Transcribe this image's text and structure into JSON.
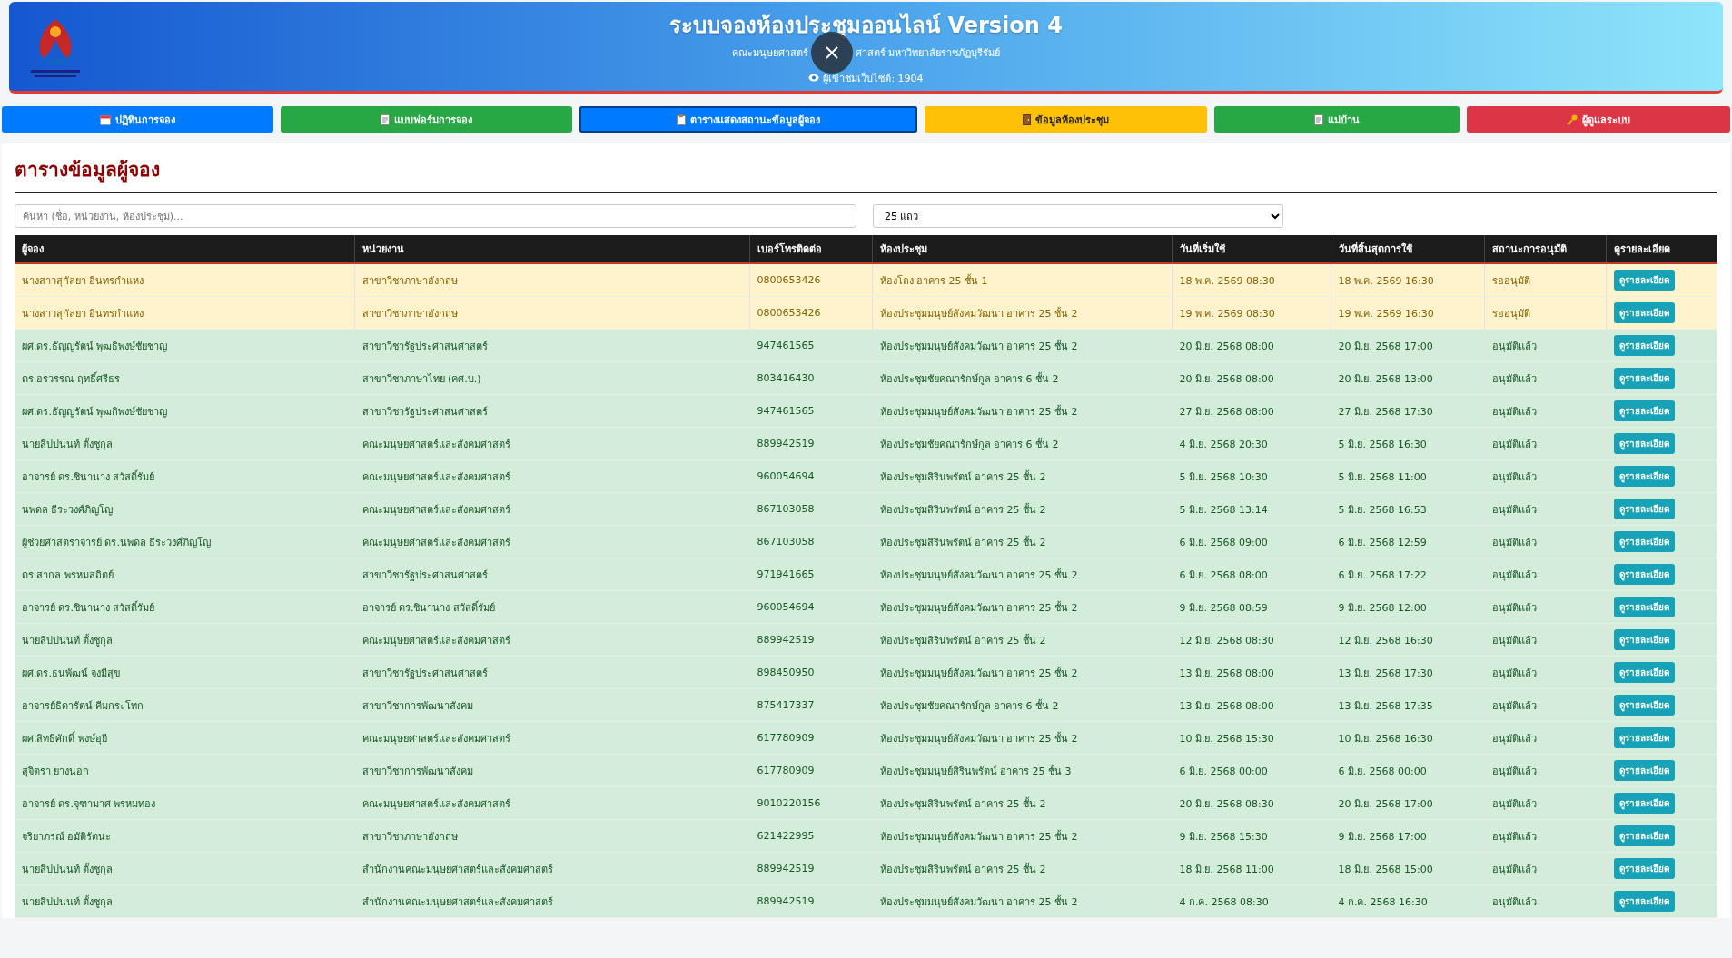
{
  "header": {
    "title": "ระบบจองห้องประชุมออนไลน์ Version 4",
    "subtitle": [
      "คณะมนุษยศาสตร์",
      "ศาสตร์ มหาวิทยาลัยราชภัฏบุรีรัมย์"
    ],
    "visitors": "ผู้เข้าชมเว็บไซต์: 1904"
  },
  "nav": [
    {
      "label": "ปฏิทินการจอง",
      "kind": "calendar",
      "color": "#007bff",
      "selected": false
    },
    {
      "label": "แบบฟอร์มการจอง",
      "kind": "document",
      "color": "#28a745",
      "selected": false
    },
    {
      "label": "ตารางแสดงสถานะข้อมูลผู้จอง",
      "kind": "clipboard",
      "color": "#007bff",
      "selected": true
    },
    {
      "label": "ข้อมูลห้องประชุม",
      "kind": "door",
      "color": "#ffc107",
      "selected": false
    },
    {
      "label": "แม่บ้าน",
      "kind": "document",
      "color": "#28a745",
      "selected": false
    },
    {
      "label": "ผู้ดูแลระบบ",
      "kind": "key",
      "color": "#dc3545",
      "selected": false
    }
  ],
  "page_title": "ตารางข้อมูลผู้จอง",
  "search": {
    "placeholder": "ค้นหา (ชื่อ, หน่วยงาน, ห้องประชุม)..."
  },
  "page_size": {
    "value": "25 แถว"
  },
  "table": {
    "columns": [
      "ผู้จอง",
      "หน่วยงาน",
      "เบอร์โทรติดต่อ",
      "ห้องประชุม",
      "วันที่เริ่มใช้",
      "วันที่สิ้นสุดการใช้",
      "สถานะการอนุมัติ",
      "ดูรายละเอียด"
    ],
    "rows": [
      {
        "name": "นางสาวสุกัลยา อินทรกำแหง",
        "unit": "สาขาวิชาภาษาอังกฤษ",
        "phone": "0800653426",
        "room": "ห้องโถง อาคาร 25 ชั้น 1",
        "start": "18 พ.ค. 2569 08:30",
        "end": "18 พ.ค. 2569 16:30",
        "status": "รออนุมัติ",
        "pending": true,
        "button": "ดูรายละเอียด"
      },
      {
        "name": "นางสาวสุกัลยา อินทรกำแหง",
        "unit": "สาขาวิชาภาษาอังกฤษ",
        "phone": "0800653426",
        "room": "ห้องประชุมมนุษย์สังคมวัฒนา อาคาร 25 ชั้น 2",
        "start": "19 พ.ค. 2569 08:30",
        "end": "19 พ.ค. 2569 16:30",
        "status": "รออนุมัติ",
        "pending": true,
        "button": "ดูรายละเอียด"
      },
      {
        "name": "ผศ.ดร.ธัญญรัตน์ พุฒธิพงษ์ชัยชาญ",
        "unit": "สาขาวิชารัฐประศาสนศาสตร์",
        "phone": "947461565",
        "room": "ห้องประชุมมนุษย์สังคมวัฒนา อาคาร 25 ชั้น 2",
        "start": "20 มิ.ย. 2568 08:00",
        "end": "20 มิ.ย. 2568 17:00",
        "status": "อนุมัติแล้ว",
        "pending": false,
        "button": "ดูรายละเอียด"
      },
      {
        "name": "ดร.อรวรรณ ฤทธิ์ศรีธร",
        "unit": "สาขาวิชาภาษาไทย (คศ.บ.)",
        "phone": "803416430",
        "room": "ห้องประชุมชัยคณารักษ์กูล อาคาร 6 ชั้น 2",
        "start": "20 มิ.ย. 2568 08:00",
        "end": "20 มิ.ย. 2568 13:00",
        "status": "อนุมัติแล้ว",
        "pending": false,
        "button": "ดูรายละเอียด"
      },
      {
        "name": "ผศ.ดร.ธัญญรัตน์ พุฒกิพงษ์ชัยชาญ",
        "unit": "สาขาวิชารัฐประศาสนศาสตร์",
        "phone": "947461565",
        "room": "ห้องประชุมมนุษย์สังคมวัฒนา อาคาร 25 ชั้น 2",
        "start": "27 มิ.ย. 2568 08:00",
        "end": "27 มิ.ย. 2568 17:30",
        "status": "อนุมัติแล้ว",
        "pending": false,
        "button": "ดูรายละเอียด"
      },
      {
        "name": "นายสิปปนนท์ ตั้งชูกุล",
        "unit": "คณะมนุษยศาสตร์และสังคมศาสตร์",
        "phone": "889942519",
        "room": "ห้องประชุมชัยคณารักษ์กูล อาคาร 6 ชั้น 2",
        "start": "4 มิ.ย. 2568 20:30",
        "end": "5 มิ.ย. 2568 16:30",
        "status": "อนุมัติแล้ว",
        "pending": false,
        "button": "ดูรายละเอียด"
      },
      {
        "name": "อาจารย์ ดร.ชินานาง สวัสดิ์รัมย์",
        "unit": "คณะมนุษยศาสตร์และสังคมศาสตร์",
        "phone": "960054694",
        "room": "ห้องประชุมสิรินพรัตน์ อาคาร 25 ชั้น 2",
        "start": "5 มิ.ย. 2568 10:30",
        "end": "5 มิ.ย. 2568 11:00",
        "status": "อนุมัติแล้ว",
        "pending": false,
        "button": "ดูรายละเอียด"
      },
      {
        "name": "นพดล ธีระวงศ์ภิญโญ",
        "unit": "คณะมนุษยศาสตร์และสังคมศาสตร์",
        "phone": "867103058",
        "room": "ห้องประชุมสิรินพรัตน์ อาคาร 25 ชั้น 2",
        "start": "5 มิ.ย. 2568 13:14",
        "end": "5 มิ.ย. 2568 16:53",
        "status": "อนุมัติแล้ว",
        "pending": false,
        "button": "ดูรายละเอียด"
      },
      {
        "name": "ผู้ช่วยศาสตราจารย์ ดร.นพดล ธีระวงศ์ภิญโญ",
        "unit": "คณะมนุษยศาสตร์และสังคมศาสตร์",
        "phone": "867103058",
        "room": "ห้องประชุมสิรินพรัตน์ อาคาร 25 ชั้น 2",
        "start": "6 มิ.ย. 2568 09:00",
        "end": "6 มิ.ย. 2568 12:59",
        "status": "อนุมัติแล้ว",
        "pending": false,
        "button": "ดูรายละเอียด"
      },
      {
        "name": "ดร.สากล พรหมสถิตย์",
        "unit": "สาขาวิชารัฐประศาสนศาสตร์",
        "phone": "971941665",
        "room": "ห้องประชุมมนุษย์สังคมวัฒนา อาคาร 25 ชั้น 2",
        "start": "6 มิ.ย. 2568 08:00",
        "end": "6 มิ.ย. 2568 17:22",
        "status": "อนุมัติแล้ว",
        "pending": false,
        "button": "ดูรายละเอียด"
      },
      {
        "name": "อาจารย์ ดร.ชินานาง สวัสดิ์รัมย์",
        "unit": "อาจารย์ ดร.ชินานาง สวัสดิ์รัมย์",
        "phone": "960054694",
        "room": "ห้องประชุมมนุษย์สังคมวัฒนา อาคาร 25 ชั้น 2",
        "start": "9 มิ.ย. 2568 08:59",
        "end": "9 มิ.ย. 2568 12:00",
        "status": "อนุมัติแล้ว",
        "pending": false,
        "button": "ดูรายละเอียด"
      },
      {
        "name": "นายสิปปนนท์ ตั้งชูกุล",
        "unit": "คณะมนุษยศาสตร์และสังคมศาสตร์",
        "phone": "889942519",
        "room": "ห้องประชุมสิรินพรัตน์ อาคาร 25 ชั้น 2",
        "start": "12 มิ.ย. 2568 08:30",
        "end": "12 มิ.ย. 2568 16:30",
        "status": "อนุมัติแล้ว",
        "pending": false,
        "button": "ดูรายละเอียด"
      },
      {
        "name": "ผศ.ดร.ธนพัฒน์ จงมีสุข",
        "unit": "สาขาวิชารัฐประศาสนศาสตร์",
        "phone": "898450950",
        "room": "ห้องประชุมมนุษย์สังคมวัฒนา อาคาร 25 ชั้น 2",
        "start": "13 มิ.ย. 2568 08:00",
        "end": "13 มิ.ย. 2568 17:30",
        "status": "อนุมัติแล้ว",
        "pending": false,
        "button": "ดูรายละเอียด"
      },
      {
        "name": "อาจารย์ธิดารัตน์ คีมกระโทก",
        "unit": "สาขาวิชาการพัฒนาสังคม",
        "phone": "875417337",
        "room": "ห้องประชุมชัยคณารักษ์กูล อาคาร 6 ชั้น 2",
        "start": "13 มิ.ย. 2568 08:00",
        "end": "13 มิ.ย. 2568 17:35",
        "status": "อนุมัติแล้ว",
        "pending": false,
        "button": "ดูรายละเอียด"
      },
      {
        "name": "ผศ.สิทธิศักดิ์ พงษ์อุยี",
        "unit": "คณะมนุษยศาสตร์และสังคมศาสตร์",
        "phone": "617780909",
        "room": "ห้องประชุมมนุษย์สังคมวัฒนา อาคาร 25 ชั้น 2",
        "start": "10 มิ.ย. 2568 15:30",
        "end": "10 มิ.ย. 2568 16:30",
        "status": "อนุมัติแล้ว",
        "pending": false,
        "button": "ดูรายละเอียด"
      },
      {
        "name": "สุจิตรา ยางนอก",
        "unit": "สาขาวิชาการพัฒนาสังคม",
        "phone": "617780909",
        "room": "ห้องประชุมมนุษย์สิรินพรัตน์ อาคาร 25 ชั้น 3",
        "start": "6 มิ.ย. 2568 00:00",
        "end": "6 มิ.ย. 2568 00:00",
        "status": "อนุมัติแล้ว",
        "pending": false,
        "button": "ดูรายละเอียด"
      },
      {
        "name": "อาจารย์ ดร.จุฑามาศ พรหมทอง",
        "unit": "คณะมนุษยศาสตร์และสังคมศาสตร์",
        "phone": "9010220156",
        "room": "ห้องประชุมสิรินพรัตน์ อาคาร 25 ชั้น 2",
        "start": "20 มิ.ย. 2568 08:30",
        "end": "20 มิ.ย. 2568 17:00",
        "status": "อนุมัติแล้ว",
        "pending": false,
        "button": "ดูรายละเอียด"
      },
      {
        "name": "จริยาภรณ์ อมัติรัตนะ",
        "unit": "สาขาวิชาภาษาอังกฤษ",
        "phone": "621422995",
        "room": "ห้องประชุมมนุษย์สังคมวัฒนา อาคาร 25 ชั้น 2",
        "start": "9 มิ.ย. 2568 15:30",
        "end": "9 มิ.ย. 2568 17:00",
        "status": "อนุมัติแล้ว",
        "pending": false,
        "button": "ดูรายละเอียด"
      },
      {
        "name": "นายสิปปนนท์ ตั้งชูกุล",
        "unit": "สำนักงานคณะมนุษยศาสตร์และสังคมศาสตร์",
        "phone": "889942519",
        "room": "ห้องประชุมสิรินพรัตน์ อาคาร 25 ชั้น 2",
        "start": "18 มิ.ย. 2568 11:00",
        "end": "18 มิ.ย. 2568 15:00",
        "status": "อนุมัติแล้ว",
        "pending": false,
        "button": "ดูรายละเอียด"
      },
      {
        "name": "นายสิปปนนท์ ตั้งชูกุล",
        "unit": "สำนักงานคณะมนุษยศาสตร์และสังคมศาสตร์",
        "phone": "889942519",
        "room": "ห้องประชุมมนุษย์สังคมวัฒนา อาคาร 25 ชั้น 2",
        "start": "4 ก.ค. 2568 08:30",
        "end": "4 ก.ค. 2568 16:30",
        "status": "อนุมัติแล้ว",
        "pending": false,
        "button": "ดูรายละเอียด"
      }
    ]
  }
}
